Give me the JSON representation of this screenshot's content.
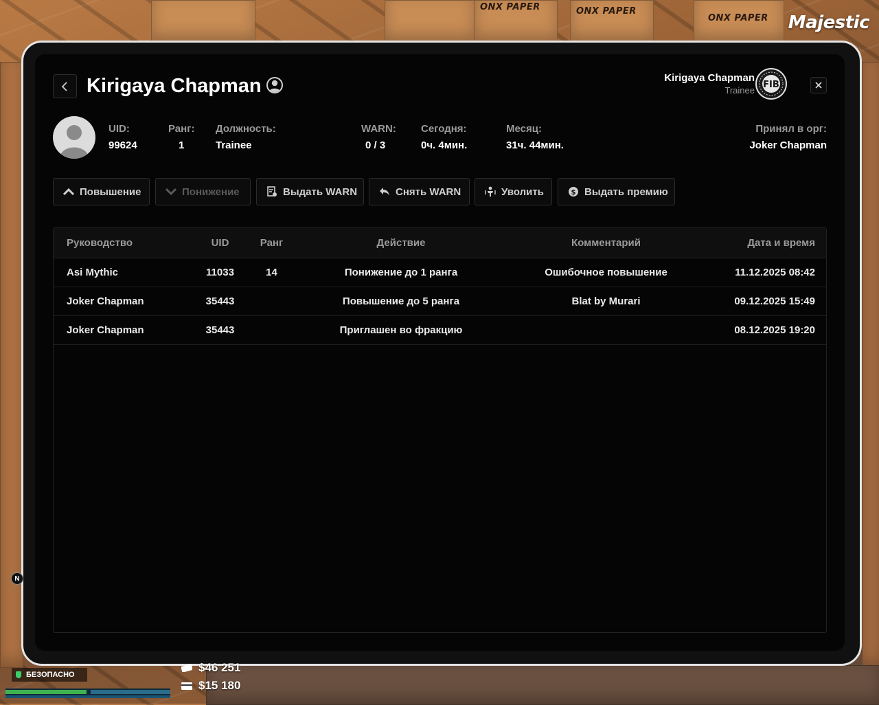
{
  "brand": "Majestic",
  "header": {
    "title": "Kirigaya Chapman",
    "current_user": {
      "name": "Kirigaya Chapman",
      "rank": "Trainee"
    },
    "org_logo_text": "FIB"
  },
  "profile": {
    "uid_label": "UID:",
    "uid": "99624",
    "rank_label": "Ранг:",
    "rank": "1",
    "position_label": "Должность:",
    "position": "Trainee",
    "warn_label": "WARN:",
    "warn": "0 / 3",
    "today_label": "Сегодня:",
    "today": "0ч. 4мин.",
    "month_label": "Месяц:",
    "month": "31ч. 44мин.",
    "hired_by_label": "Принял в орг:",
    "hired_by": "Joker Chapman"
  },
  "actions": [
    {
      "label": "Повышение",
      "icon": "chevron-up-icon",
      "disabled": false
    },
    {
      "label": "Понижение",
      "icon": "chevron-down-icon",
      "disabled": true
    },
    {
      "label": "Выдать WARN",
      "icon": "warn-doc-icon",
      "disabled": false
    },
    {
      "label": "Снять WARN",
      "icon": "reply-arrow-icon",
      "disabled": false
    },
    {
      "label": "Уволить",
      "icon": "fire-user-icon",
      "disabled": false
    },
    {
      "label": "Выдать премию",
      "icon": "dollar-coin-icon",
      "disabled": false
    }
  ],
  "table": {
    "columns": [
      "Руководство",
      "UID",
      "Ранг",
      "Действие",
      "Комментарий",
      "Дата и время"
    ],
    "rows": [
      [
        "Asi Mythic",
        "11033",
        "14",
        "Понижение до 1 ранга",
        "Ошибочное повышение",
        "11.12.2025 08:42"
      ],
      [
        "Joker Chapman",
        "35443",
        "",
        "Повышение до 5 ранга",
        "Blat by Murari",
        "09.12.2025 15:49"
      ],
      [
        "Joker Chapman",
        "35443",
        "",
        "Приглашен во фракцию",
        "",
        "08.12.2025 19:20"
      ]
    ]
  },
  "hud": {
    "zone": "БЕЗОПАСНО",
    "cash": "$46 251",
    "bank": "$15 180",
    "compass": "N"
  }
}
